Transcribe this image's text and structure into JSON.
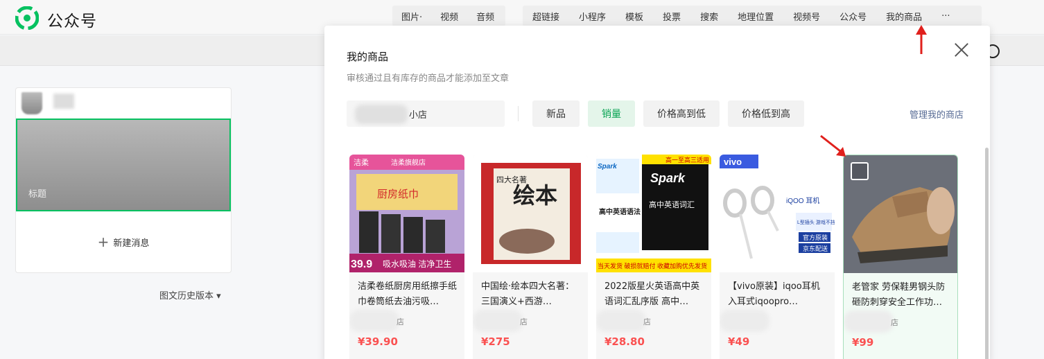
{
  "app": {
    "name": "公众号",
    "brand_color": "#07c160"
  },
  "toolbar": {
    "group_a": [
      "图片·",
      "视频",
      "音频"
    ],
    "group_b": [
      "超链接",
      "小程序",
      "模板",
      "投票",
      "搜索",
      "地理位置",
      "视频号",
      "公众号",
      "我的商品",
      "···"
    ]
  },
  "editor": {
    "cover_title": "标题",
    "new_message": "新建消息",
    "history": "图文历史版本 ▾"
  },
  "modal": {
    "title": "我的商品",
    "subtitle": "审核通过且有库存的商品才能添加至文章",
    "shop_name_suffix": "小店",
    "sort_buttons": [
      "新品",
      "销量",
      "价格高到低",
      "价格低到高"
    ],
    "active_sort": "销量",
    "manage_link": "管理我的商店",
    "active_color": "#07a352",
    "price_color": "#fa5151"
  },
  "products": [
    {
      "title": "洁柔卷纸厨房用纸擦手纸巾卷筒纸去油污吸…",
      "store_suffix": "店",
      "price": "¥39.90",
      "selected": false,
      "thumb_text": {
        "brand": "洁柔",
        "shop": "洁柔旗舰店",
        "product": "厨房纸巾",
        "price_tag": "39.9",
        "slogan": "吸水吸油 洁净卫生"
      }
    },
    {
      "title": "中国绘·绘本四大名著：三国演义+西游…",
      "store_suffix": "店",
      "price": "¥275",
      "selected": false,
      "thumb_text": {
        "big": "绘本",
        "side": "四大名著"
      }
    },
    {
      "title": "2022版星火英语高中英语词汇乱序版 高中…",
      "store_suffix": "店",
      "price": "¥28.80",
      "selected": false,
      "thumb_text": {
        "corner": "高一至高三适用",
        "spark": "Spark",
        "book": "高中英语词汇",
        "left_book": "高中英语语法",
        "footer": "当天发货 破损就赔付 收藏加购优先发货"
      }
    },
    {
      "title": "【vivo原装】iqoo耳机入耳式iqoopro…",
      "store_suffix": "",
      "price": "¥49",
      "selected": false,
      "thumb_text": {
        "brand": "vivo",
        "iqoo": "iQOO 耳机",
        "tag1": "L型插头 游戏不挡手",
        "tag2": "官方原装",
        "tag3": "京东配送"
      }
    },
    {
      "title": "老管家 劳保鞋男钢头防砸防刺穿安全工作功…",
      "store_suffix": "店",
      "price": "¥99",
      "selected": true,
      "thumb_text": {}
    }
  ]
}
